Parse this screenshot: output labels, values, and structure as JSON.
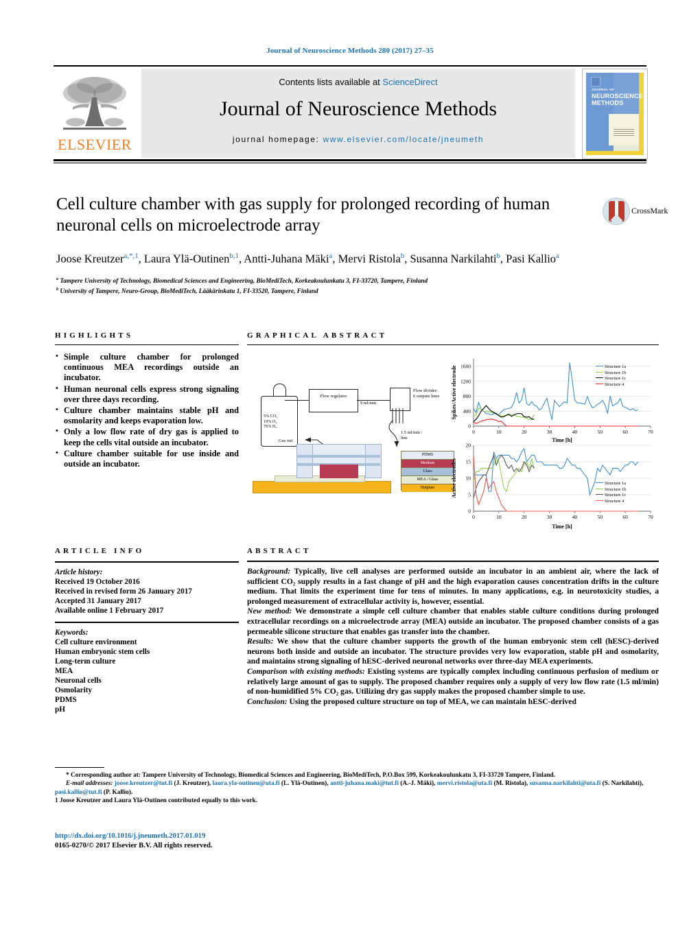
{
  "running_head": "Journal of Neuroscience Methods 280 (2017) 27–35",
  "masthead": {
    "contents_prefix": "Contents lists available at ",
    "contents_link": "ScienceDirect",
    "journal_title": "Journal of Neuroscience Methods",
    "homepage_prefix": "journal homepage: ",
    "homepage_link": "www.elsevier.com/locate/jneumeth",
    "publisher_logo_text": "ELSEVIER",
    "cover_line1": "JOURNAL OF",
    "cover_line2": "NEUROSCIENCE",
    "cover_line3": "METHODS"
  },
  "article": {
    "title": "Cell culture chamber with gas supply for prolonged recording of human neuronal cells on microelectrode array",
    "authors_html": "Joose Kreutzer<sup class=\"supblue\">a</sup><sup class=\"supblue\">,</sup><sup class=\"supblue\">*</sup><sup class=\"supblue\">,1</sup>, Laura Ylä-Outinen<sup class=\"supblue\">b</sup><sup class=\"supblue\">,1</sup>, Antti-Juhana Mäki<sup class=\"supblue\">a</sup>, Mervi Ristola<sup class=\"supblue\">b</sup>, Susanna Narkilahti<sup class=\"supblue\">b</sup>, Pasi Kallio<sup class=\"supblue\">a</sup>",
    "affiliation_a": "Tampere University of Technology, Biomedical Sciences and Engineering, BioMediTech, Korkeakoulunkatu 3, FI-33720, Tampere, Finland",
    "affiliation_b": "University of Tampere, Neuro-Group, BioMediTech, Lääkärinkatu 1, FI-33520, Tampere, Finland",
    "crossmark_label": "CrossMark"
  },
  "highlights": {
    "heading": "HIGHLIGHTS",
    "items": [
      "Simple culture chamber for prolonged continuous MEA recordings outside an incubator.",
      "Human neuronal cells express strong signaling over three days recording.",
      "Culture chamber maintains stable pH and osmolarity and keeps evaporation low.",
      "Only a low flow rate of dry gas is applied to keep the cells vital outside an incubator.",
      "Culture chamber suitable for use inside and outside an incubator."
    ]
  },
  "graphical_abstract": {
    "heading": "GRAPHICAL ABSTRACT",
    "diagram": {
      "cylinder_label": "5% CO₂\n19% O₂\n76% N₂",
      "cylinder_l1": "5% CO₂",
      "cylinder_l2": "19% O₂",
      "cylinder_l3": "76% N₂",
      "regulator_label": "Flow regulator",
      "flow_rate_main": "9 ml/min",
      "divider_label_l1": "Flow divider:",
      "divider_label_l2": "6 outputs lines",
      "flow_rate_line_l1": "1.5 ml/min /",
      "flow_rate_line_l2": "line",
      "gas_out_label": "Gas out",
      "layers": [
        {
          "name": "PDMS",
          "color": "#e6edf7"
        },
        {
          "name": "Medium",
          "color": "#b63a52"
        },
        {
          "name": "Glass",
          "color": "#a9c0d9"
        },
        {
          "name": "MEA / Glass",
          "color": "#e8ecd4"
        },
        {
          "name": "Hotplate",
          "color": "#f5b41a"
        }
      ]
    }
  },
  "chart_data": [
    {
      "type": "line",
      "title": "",
      "xlabel": "Time [h]",
      "ylabel": "Spikes/Active electrode",
      "xlim": [
        0,
        70
      ],
      "ylim": [
        0,
        1800
      ],
      "xticks": [
        0,
        10,
        20,
        30,
        40,
        50,
        60,
        70
      ],
      "yticks": [
        0,
        400,
        800,
        1200,
        1600
      ],
      "grid": true,
      "legend_position": "top-right",
      "series": [
        {
          "name": "Structure 1a",
          "color": "#3f8fd0",
          "x": [
            0,
            1,
            2,
            3,
            4,
            5,
            6,
            7,
            8,
            9,
            10,
            11,
            12,
            13,
            14,
            15,
            16,
            17,
            18,
            19,
            20,
            21,
            22,
            23,
            24,
            25,
            26,
            27,
            28,
            29,
            30,
            31,
            32,
            33,
            34,
            35,
            36,
            37,
            38,
            39,
            40,
            41,
            42,
            43,
            44,
            45,
            46,
            47,
            48,
            49,
            50,
            51,
            52,
            53,
            54,
            55,
            56,
            57,
            58,
            59,
            60,
            61,
            62,
            63,
            64,
            65
          ],
          "values": [
            480,
            360,
            640,
            450,
            400,
            330,
            330,
            300,
            340,
            320,
            300,
            380,
            440,
            460,
            470,
            500,
            640,
            900,
            620,
            700,
            1030,
            600,
            560,
            660,
            560,
            530,
            430,
            480,
            620,
            750,
            450,
            170,
            690,
            600,
            520,
            600,
            650,
            620,
            1700,
            1250,
            700,
            620,
            620,
            600,
            590,
            790,
            610,
            490,
            520,
            580,
            620,
            690,
            560,
            340,
            810,
            540,
            580,
            620,
            740,
            530,
            500,
            470,
            430,
            470,
            410,
            440
          ]
        },
        {
          "name": "Structure 1b",
          "color": "#92d050",
          "x": [
            0,
            1,
            2,
            3,
            4,
            5,
            6,
            7,
            8,
            9,
            10,
            11,
            12,
            13,
            14,
            15,
            16,
            17,
            18,
            19,
            20,
            21,
            22,
            23,
            24
          ],
          "values": [
            260,
            300,
            480,
            460,
            400,
            380,
            390,
            370,
            360,
            340,
            290,
            270,
            270,
            300,
            290,
            300,
            300,
            260,
            250,
            240,
            240,
            200,
            180,
            180,
            310
          ]
        },
        {
          "name": "Structure 1c",
          "color": "#000000",
          "x": [
            0,
            1,
            2,
            3,
            4,
            5,
            6,
            7,
            8,
            9,
            10,
            11,
            12,
            13,
            14,
            15,
            16,
            17,
            18,
            19,
            20,
            21,
            22,
            23,
            24
          ],
          "values": [
            120,
            180,
            280,
            400,
            470,
            550,
            470,
            400,
            370,
            330,
            280,
            240,
            250,
            290,
            320,
            260,
            300,
            330,
            340,
            330,
            250,
            240,
            250,
            190,
            180
          ]
        },
        {
          "name": "Structure 4",
          "color": "#e8262b",
          "x": [
            0,
            1,
            2,
            3,
            4,
            5,
            6,
            7,
            8,
            9,
            10,
            11,
            12,
            13,
            20,
            30,
            40,
            50,
            60,
            65
          ],
          "values": [
            110,
            70,
            100,
            130,
            150,
            170,
            180,
            190,
            170,
            160,
            120,
            130,
            60,
            0,
            0,
            0,
            0,
            0,
            0,
            0
          ]
        }
      ]
    },
    {
      "type": "line",
      "title": "",
      "xlabel": "Time [h]",
      "ylabel": "Active electrodes",
      "xlim": [
        0,
        70
      ],
      "ylim": [
        0,
        20
      ],
      "xticks": [
        0,
        10,
        20,
        30,
        40,
        50,
        60,
        70
      ],
      "yticks": [
        0,
        5,
        10,
        15,
        20
      ],
      "grid": true,
      "legend_position": "right",
      "series": [
        {
          "name": "Structure 1a",
          "color": "#3f8fd0",
          "x": [
            0,
            1,
            2,
            3,
            4,
            5,
            6,
            7,
            8,
            9,
            10,
            11,
            12,
            13,
            14,
            15,
            16,
            17,
            18,
            19,
            20,
            21,
            22,
            23,
            24,
            25,
            26,
            27,
            28,
            29,
            30,
            31,
            32,
            33,
            34,
            35,
            36,
            37,
            38,
            39,
            40,
            41,
            42,
            43,
            44,
            45,
            46,
            47,
            48,
            49,
            50,
            51,
            52,
            53,
            54,
            55,
            56,
            57,
            58,
            59,
            60,
            61,
            62,
            63,
            64,
            65
          ],
          "values": [
            11,
            11,
            11,
            11,
            11,
            11,
            6,
            6,
            18,
            16,
            17,
            17,
            17,
            17,
            17,
            16,
            16,
            15,
            16,
            18,
            19,
            15,
            16,
            17,
            17,
            15,
            15,
            15,
            14,
            14,
            14,
            14,
            14,
            14,
            13,
            13,
            14,
            16,
            15,
            14,
            14,
            13,
            13,
            12,
            11,
            10,
            5,
            7,
            9,
            13,
            12,
            14,
            13,
            12,
            11,
            13,
            13,
            13,
            12,
            13,
            14,
            14,
            15,
            15,
            14,
            15
          ]
        },
        {
          "name": "Structure 1b",
          "color": "#92d050",
          "x": [
            0,
            1,
            2,
            3,
            4,
            5,
            6,
            7,
            8,
            9,
            10,
            11,
            12,
            13,
            14,
            15,
            16,
            17,
            18,
            19,
            20,
            21,
            22,
            23,
            24
          ],
          "values": [
            9,
            12,
            12,
            13,
            13,
            13,
            13,
            13,
            14,
            16,
            15,
            11,
            7,
            6,
            9,
            10,
            11,
            12,
            13,
            12,
            14,
            15,
            13,
            16,
            13
          ]
        },
        {
          "name": "Structure 1c",
          "color": "#555555",
          "x": [
            0,
            1,
            2,
            3,
            4,
            5,
            6,
            7,
            8,
            9,
            10,
            11,
            12,
            13,
            14,
            15,
            16,
            17,
            18,
            19,
            20,
            21,
            22,
            23,
            24
          ],
          "values": [
            4,
            7,
            9,
            10,
            11,
            11,
            13,
            15,
            17,
            14,
            16,
            17,
            16,
            14,
            13,
            14,
            12,
            13,
            12,
            13,
            15,
            14,
            12,
            14,
            13
          ]
        },
        {
          "name": "Structure 4",
          "color": "#f8554a",
          "x": [
            0,
            1,
            2,
            3,
            4,
            5,
            6,
            7,
            8,
            9,
            10,
            11,
            12,
            13,
            20,
            30,
            40,
            50,
            60,
            65
          ],
          "values": [
            17,
            5,
            2,
            4,
            6,
            10,
            7,
            8,
            9,
            6,
            4,
            2,
            1,
            0,
            0,
            0,
            0,
            0,
            0,
            0
          ]
        }
      ]
    }
  ],
  "article_info": {
    "heading": "ARTICLE INFO",
    "history_label": "Article history:",
    "history": [
      "Received 19 October 2016",
      "Received in revised form 26 January 2017",
      "Accepted 31 January 2017",
      "Available online 1 February 2017"
    ],
    "keywords_label": "Keywords:",
    "keywords": [
      "Cell culture environment",
      "Human embryonic stem cells",
      "Long-term culture",
      "MEA",
      "Neuronal cells",
      "Osmolarity",
      "PDMS",
      "pH"
    ]
  },
  "abstract": {
    "heading": "ABSTRACT",
    "paragraphs": [
      {
        "lead": "Background:",
        "text": " Typically, live cell analyses are performed outside an incubator in an ambient air, where the lack of sufficient CO₂ supply results in a fast change of pH and the high evaporation causes concentration drifts in the culture medium. That limits the experiment time for tens of minutes. In many applications, e.g. in neurotoxicity studies, a prolonged measurement of extracellular activity is, however, essential."
      },
      {
        "lead": "New method:",
        "text": " We demonstrate a simple cell culture chamber that enables stable culture conditions during prolonged extracellular recordings on a microelectrode array (MEA) outside an incubator. The proposed chamber consists of a gas permeable silicone structure that enables gas transfer into the chamber."
      },
      {
        "lead": "Results:",
        "text": " We show that the culture chamber supports the growth of the human embryonic stem cell (hESC)-derived neurons both inside and outside an incubator. The structure provides very low evaporation, stable pH and osmolarity, and maintains strong signaling of hESC-derived neuronal networks over three-day MEA experiments."
      },
      {
        "lead": "Comparison with existing methods:",
        "text": " Existing systems are typically complex including continuous perfusion of medium or relatively large amount of gas to supply. The proposed chamber requires only a supply of very low flow rate (1.5 ml/min) of non-humidified 5% CO₂ gas. Utilizing dry gas supply makes the proposed chamber simple to use."
      },
      {
        "lead": "Conclusion:",
        "text": " Using the proposed culture structure on top of MEA, we can maintain hESC-derived"
      }
    ]
  },
  "footnotes": {
    "corresponding": "* Corresponding author at: Tampere University of Technology, Biomedical Sciences and Engineering, BioMediTech, P.O.Box 599, Korkeakoulunkatu 3, FI-33720 Tampere, Finland.",
    "email_label": "E-mail addresses:",
    "emails": [
      {
        "addr": "joose.kreutzer@tut.fi",
        "who": " (J. Kreutzer), "
      },
      {
        "addr": "laura.yla-outinen@uta.fi",
        "who": " (L. Ylä-Outinen), "
      },
      {
        "addr": "antti-juhana.maki@tut.fi",
        "who": " (A.-J. Mäki), "
      },
      {
        "addr": "mervi.ristola@uta.fi",
        "who": " (M. Ristola), "
      },
      {
        "addr": "susanna.narkilahti@uta.fi",
        "who": " (S. Narkilahti), "
      },
      {
        "addr": "pasi.kallio@tut.fi",
        "who": " (P. Kallio)."
      }
    ],
    "equal_contribution": "1 Joose Kreutzer and Laura Ylä-Outinen contributed equally to this work."
  },
  "footer": {
    "doi": "http://dx.doi.org/10.1016/j.jneumeth.2017.01.019",
    "copyright": "0165-0270/© 2017 Elsevier B.V. All rights reserved."
  }
}
